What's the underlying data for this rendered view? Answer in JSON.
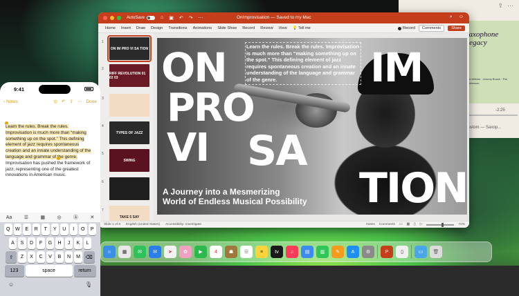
{
  "music": {
    "album_line1": "Saxophone",
    "album_line2": "Legacy",
    "credits": "Jack Wilkins · Jeremy Brown · Pat Bamberson",
    "time": "-2:25",
    "track": "Custom — Saxop..."
  },
  "ppt": {
    "autosave_label": "AutoSave",
    "title": "OnImprovisation — Saved to my Mac",
    "tabs": [
      "Home",
      "Insert",
      "Draw",
      "Design",
      "Transitions",
      "Animations",
      "Slide Show",
      "Record",
      "Review",
      "View"
    ],
    "tell_me": "Tell me",
    "record": "Record",
    "comments": "Comments",
    "share": "Share",
    "thumbnails": [
      {
        "num": "1",
        "text": "ON IM PRO VI SA TION",
        "bg": "#2a2a2a"
      },
      {
        "num": "2",
        "text": "RIFF REVOLUTION 01 02 03",
        "bg": "#6a1a24"
      },
      {
        "num": "3",
        "text": "",
        "bg": "#f3dcc4"
      },
      {
        "num": "4",
        "text": "TYPES OF JAZZ",
        "bg": "#2a2a2a"
      },
      {
        "num": "5",
        "text": "SWING",
        "bg": "#5a1220"
      },
      {
        "num": "6",
        "text": "",
        "bg": "#1e1e1e"
      },
      {
        "num": "7",
        "text": "TAKE 5 SAY",
        "bg": "#f3dcc4"
      }
    ],
    "slide": {
      "quote": "Learn the rules. Break the rules. Improvisation is much more than “making something up on the spot.” This defining element of jazz requires spontaneous creation and an innate understanding of the language and grammar of the genre.",
      "w1": "ON",
      "w2": "IM",
      "w3": "PRO",
      "w4": "VI",
      "w5": "SA",
      "w6": "TION",
      "subtitle_l1": "A Journey into a Mesmerizing",
      "subtitle_l2": "World of Endless Musical Possibility"
    },
    "status": {
      "slide_of": "Slide 1 of 8",
      "language": "English (United States)",
      "accessibility": "Accessibility: Investigate",
      "notes": "Notes",
      "comments": "Comments",
      "zoom": "72%"
    }
  },
  "phone": {
    "time": "9:41",
    "back": "Notes",
    "done": "Done",
    "note_highlight": "Learn the rules. Break the rules. Improvisation is much more than “making something up on the spot.” This defining element of jazz requires spontaneous creation and an innate understanding of the language and grammar of the genre.",
    "note_rest": " Improvisation has pushed the framework of jazz, representing one of the greatest innovations in American music.",
    "format_bar": [
      "Aa",
      "☰",
      "▦",
      "◎",
      "Ⓐ",
      "✕"
    ],
    "keys_row1": [
      "Q",
      "W",
      "E",
      "R",
      "T",
      "Y",
      "U",
      "I",
      "O",
      "P"
    ],
    "keys_row2": [
      "A",
      "S",
      "D",
      "F",
      "G",
      "H",
      "J",
      "K",
      "L"
    ],
    "keys_row3": [
      "Z",
      "X",
      "C",
      "V",
      "B",
      "N",
      "M"
    ],
    "key_123": "123",
    "key_space": "space",
    "key_return": "return"
  },
  "colors": {
    "accent": "#c43e1c",
    "notes_yellow": "#d4a000"
  }
}
